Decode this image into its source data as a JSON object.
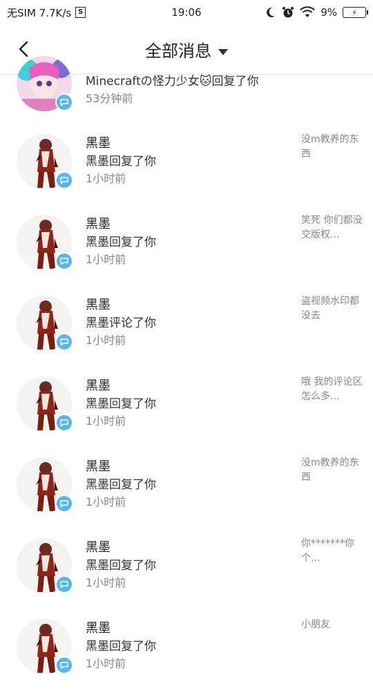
{
  "status": {
    "carrier": "无SIM 7.7K/s",
    "sim_icon": "S",
    "time": "19:06",
    "battery": "9%"
  },
  "header": {
    "title": "全部消息",
    "back_icon": "chevron-left-icon",
    "dropdown_icon": "caret-down-icon"
  },
  "first_item": {
    "action": "Minecraftの怪力少女🐱回复了你",
    "time": "53分钟前"
  },
  "items": [
    {
      "name": "黑墨",
      "action": "黑墨回复了你",
      "time": "1小时前",
      "preview": "没m教养的东西"
    },
    {
      "name": "黑墨",
      "action": "黑墨回复了你",
      "time": "1小时前",
      "preview": "笑死 你们都没交版权..."
    },
    {
      "name": "黑墨",
      "action": "黑墨评论了你",
      "time": "1小时前",
      "preview": "盗视频水印都没去"
    },
    {
      "name": "黑墨",
      "action": "黑墨回复了你",
      "time": "1小时前",
      "preview": "哦 我的评论区怎么多..."
    },
    {
      "name": "黑墨",
      "action": "黑墨回复了你",
      "time": "1小时前",
      "preview": "没m教养的东西"
    },
    {
      "name": "黑墨",
      "action": "黑墨回复了你",
      "time": "1小时前",
      "preview": "你*******你个..."
    },
    {
      "name": "黑墨",
      "action": "黑墨回复了你",
      "time": "1小时前",
      "preview": "小朋友"
    }
  ],
  "colors": {
    "badge": "#55b6f2",
    "divider": "#e6e6e6"
  }
}
